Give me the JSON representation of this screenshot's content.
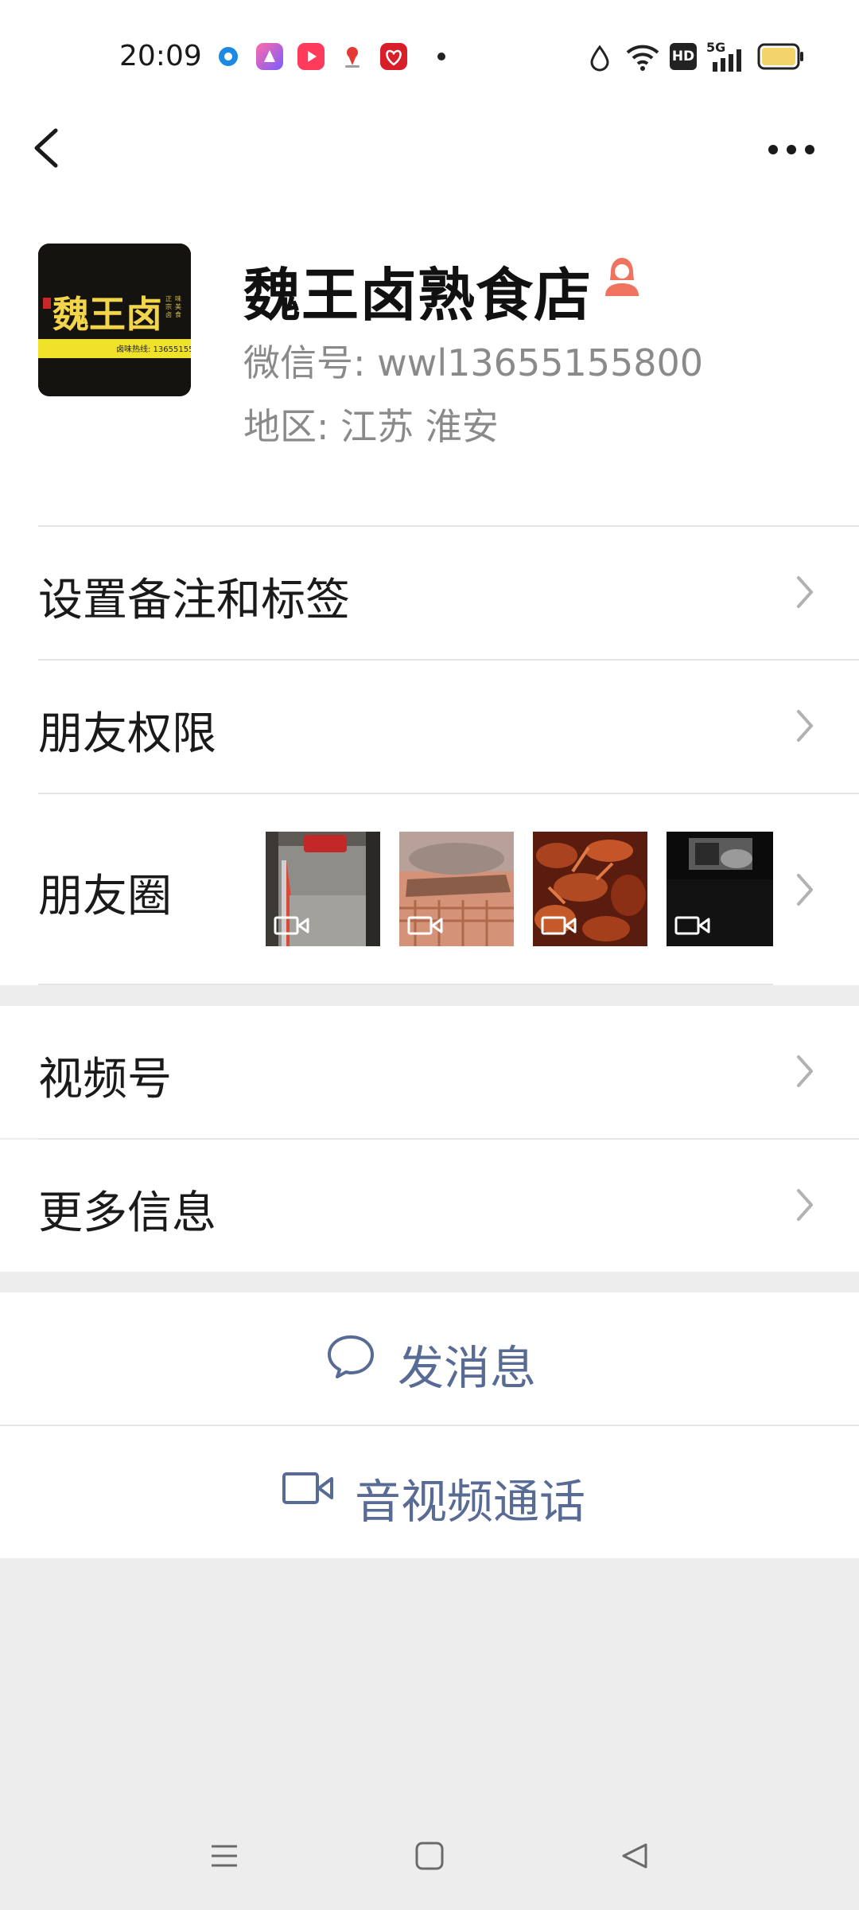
{
  "status_bar": {
    "time": "20:09",
    "network": "5G",
    "hd_badge": "HD",
    "icons": [
      "dot-app-icon",
      "app-icon-purple",
      "video-app-icon",
      "location-app-icon",
      "heart-app-icon",
      "water-drop-icon",
      "wifi-icon",
      "hd-icon",
      "signal-icon",
      "battery-icon"
    ]
  },
  "nav": {
    "back_icon": "chevron-left-icon",
    "more_icon": "ellipsis-icon"
  },
  "profile": {
    "name": "魏王卤熟食店",
    "wechat_id": "微信号:  wwl13655155800",
    "region": "地区:  江苏  淮安",
    "avatar_text": "魏王卤",
    "avatar_phone": "卤味热线: 13655155",
    "gender_icon": "female-user-icon"
  },
  "menu": {
    "remarks_label": "设置备注和标签",
    "permissions_label": "朋友权限",
    "moments_label": "朋友圈",
    "channels_label": "视频号",
    "more_info_label": "更多信息"
  },
  "actions": {
    "message_label": "发消息",
    "call_label": "音视频通话",
    "message_icon": "chat-bubble-icon",
    "call_icon": "video-camera-icon"
  },
  "colors": {
    "link": "#576b95",
    "background": "#ededed",
    "gender": "#f0735f"
  }
}
